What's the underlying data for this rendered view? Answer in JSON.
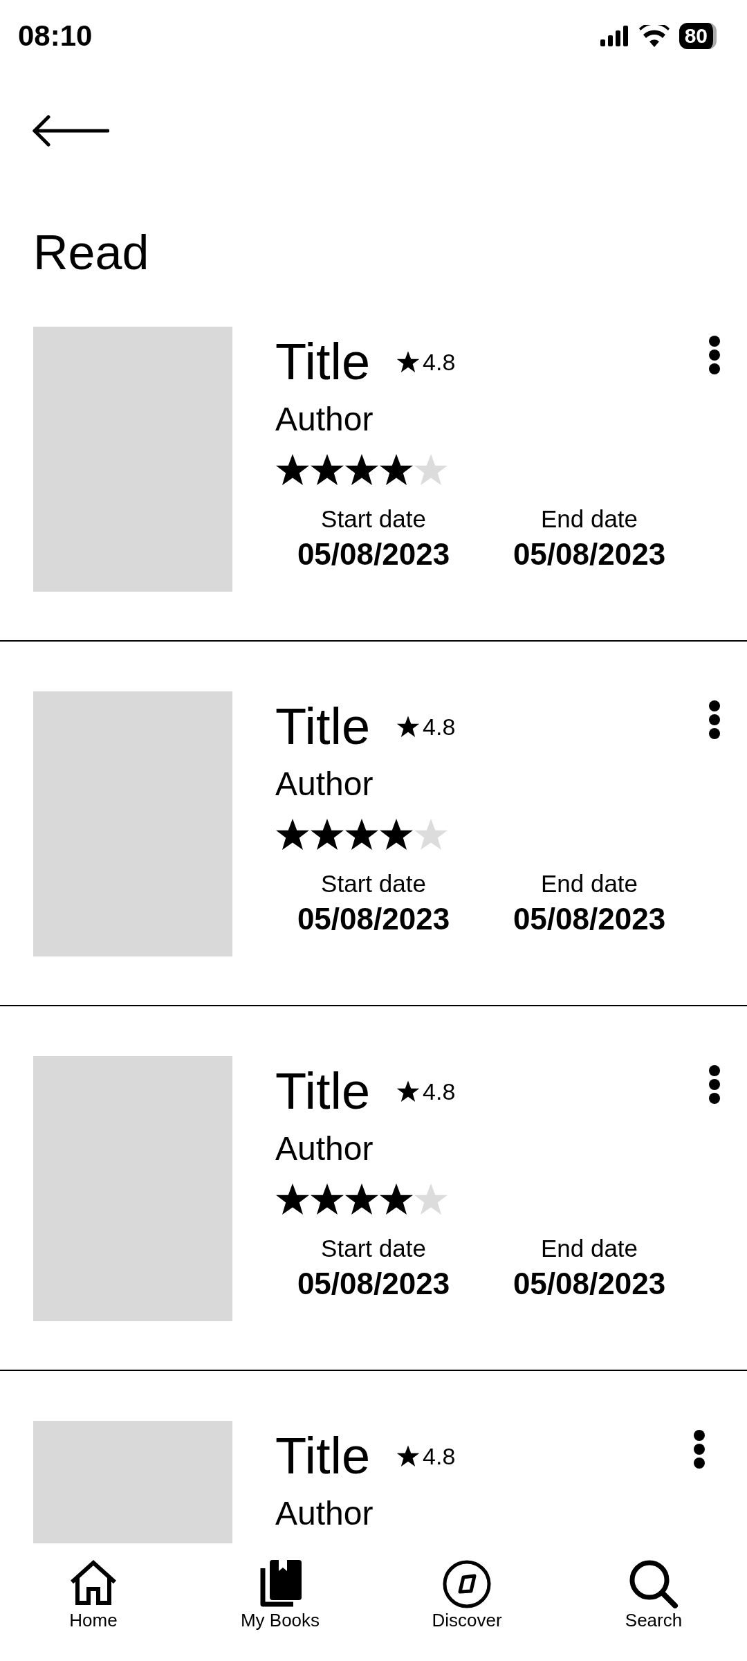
{
  "status_bar": {
    "time": "08:10",
    "battery": "80"
  },
  "page": {
    "title": "Read"
  },
  "cards": [
    {
      "title": "Title",
      "rating": "4.8",
      "author": "Author",
      "stars": 4,
      "start_label": "Start date",
      "start_date": "05/08/2023",
      "end_label": "End date",
      "end_date": "05/08/2023"
    },
    {
      "title": "Title",
      "rating": "4.8",
      "author": "Author",
      "stars": 4,
      "start_label": "Start date",
      "start_date": "05/08/2023",
      "end_label": "End date",
      "end_date": "05/08/2023"
    },
    {
      "title": "Title",
      "rating": "4.8",
      "author": "Author",
      "stars": 4,
      "start_label": "Start date",
      "start_date": "05/08/2023",
      "end_label": "End date",
      "end_date": "05/08/2023"
    },
    {
      "title": "Title",
      "rating": "4.8",
      "author": "Author"
    }
  ],
  "nav": [
    {
      "kind": "home",
      "label": "Home"
    },
    {
      "kind": "books",
      "label": "My Books"
    },
    {
      "kind": "discover",
      "label": "Discover"
    },
    {
      "kind": "search",
      "label": "Search"
    }
  ]
}
